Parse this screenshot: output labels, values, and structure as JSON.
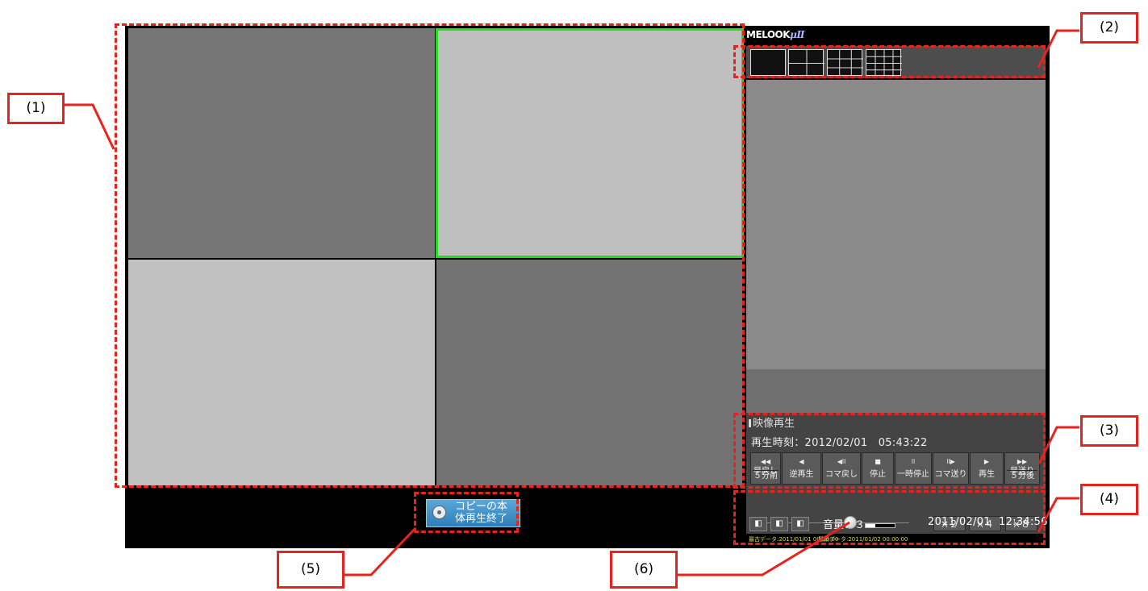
{
  "app": {
    "logo": "MELOOK",
    "logo_suffix": "μⅡ"
  },
  "layout_buttons": [
    {
      "icon": "layout-1-icon"
    },
    {
      "icon": "layout-4-icon"
    },
    {
      "icon": "layout-9-icon"
    },
    {
      "icon": "layout-16-icon"
    }
  ],
  "playback": {
    "title": "映像再生",
    "time_label": "再生時刻：2012/02/01　05:43:22",
    "buttons": [
      {
        "symbol": "◀◀",
        "label": "早戻し",
        "sub": "５分前"
      },
      {
        "symbol": "◀",
        "label": "逆再生"
      },
      {
        "symbol": "◀ll",
        "label": "コマ戻し"
      },
      {
        "symbol": "■",
        "label": "停止"
      },
      {
        "symbol": "ll",
        "label": "一時停止"
      },
      {
        "symbol": "ll▶",
        "label": "コマ送り"
      },
      {
        "symbol": "▶",
        "label": "再生"
      },
      {
        "symbol": "▶▶",
        "label": "早送り",
        "sub": "５分後"
      }
    ],
    "speeds": [
      "×２",
      "×４",
      "×８"
    ]
  },
  "status": {
    "volume_label": "音量：３",
    "volume_level": 3,
    "date": "2011/02/01",
    "time": "12:34:56",
    "oldest_data": "最古データ:2011/01/01 00:00:00",
    "newest_data": "最新データ:2011/01/02 00:00:00"
  },
  "copy_button": {
    "label_line1": "コピーの本",
    "label_line2": "体再生終了"
  },
  "annotations": [
    "(1)",
    "(2)",
    "(3)",
    "(4)",
    "(5)",
    "(6)"
  ],
  "colors": {
    "annotation": "#e8221c",
    "selected_camera": "#22dd22"
  }
}
